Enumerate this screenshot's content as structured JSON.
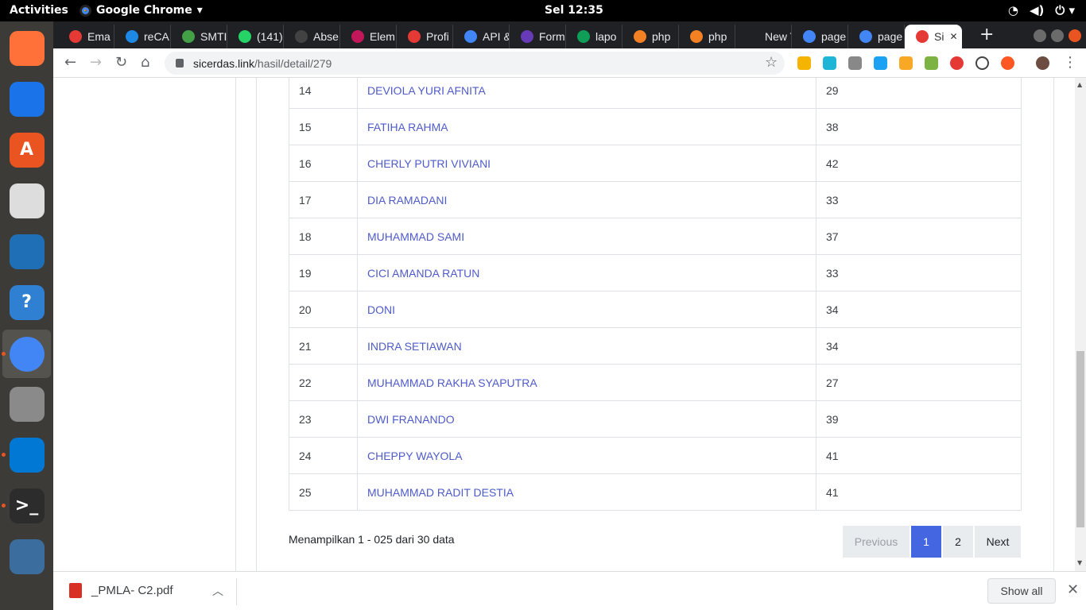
{
  "topbar": {
    "activities": "Activities",
    "app": "Google Chrome",
    "clock": "Sel 12:35"
  },
  "tabs": [
    {
      "label": "Ema",
      "color": "#e53935"
    },
    {
      "label": "reCA",
      "color": "#1e88e5"
    },
    {
      "label": "SMTI",
      "color": "#43a047"
    },
    {
      "label": "(141)",
      "color": "#25d366"
    },
    {
      "label": "Abse",
      "color": "#424242"
    },
    {
      "label": "Elem",
      "color": "#c2185b"
    },
    {
      "label": "Profi",
      "color": "#e53935"
    },
    {
      "label": "API &",
      "color": "#4285f4"
    },
    {
      "label": "Form",
      "color": "#673ab7"
    },
    {
      "label": "lapo",
      "color": "#0f9d58"
    },
    {
      "label": "php",
      "color": "#f48024"
    },
    {
      "label": "php",
      "color": "#f48024"
    },
    {
      "label": "New Tab",
      "color": "#1f2125"
    },
    {
      "label": "page",
      "color": "#4285f4"
    },
    {
      "label": "page",
      "color": "#4285f4"
    },
    {
      "label": "Si",
      "color": "#e53935"
    }
  ],
  "address": {
    "domain": "sicerdas.link",
    "path": "/hasil/detail/279"
  },
  "table": {
    "rows": [
      {
        "no": "14",
        "name": "DEVIOLA YURI AFNITA",
        "score": "29"
      },
      {
        "no": "15",
        "name": "FATIHA RAHMA",
        "score": "38"
      },
      {
        "no": "16",
        "name": "CHERLY PUTRI VIVIANI",
        "score": "42"
      },
      {
        "no": "17",
        "name": "DIA RAMADANI",
        "score": "33"
      },
      {
        "no": "18",
        "name": "MUHAMMAD SAMI",
        "score": "37"
      },
      {
        "no": "19",
        "name": "CICI AMANDA RATUN",
        "score": "33"
      },
      {
        "no": "20",
        "name": "DONI",
        "score": "34"
      },
      {
        "no": "21",
        "name": "INDRA SETIAWAN",
        "score": "34"
      },
      {
        "no": "22",
        "name": "MUHAMMAD RAKHA SYAPUTRA",
        "score": "27"
      },
      {
        "no": "23",
        "name": "DWI FRANANDO",
        "score": "39"
      },
      {
        "no": "24",
        "name": "CHEPPY WAYOLA",
        "score": "41"
      },
      {
        "no": "25",
        "name": "MUHAMMAD RADIT DESTIA",
        "score": "41"
      }
    ]
  },
  "info": "Menampilkan 1 - 025 dari 30 data",
  "pager": {
    "prev": "Previous",
    "p1": "1",
    "p2": "2",
    "next": "Next"
  },
  "downloads": {
    "file": "_PMLA- C2.pdf",
    "show_all": "Show all"
  },
  "dock": [
    {
      "name": "firefox-icon",
      "color": "#ff7139",
      "glyph": ""
    },
    {
      "name": "thunderbird-icon",
      "color": "#1a73e8",
      "glyph": ""
    },
    {
      "name": "software-center-icon",
      "color": "#e95420",
      "glyph": "A"
    },
    {
      "name": "rhythmbox-icon",
      "color": "#ddd",
      "glyph": ""
    },
    {
      "name": "writer-icon",
      "color": "#1e6fb5",
      "glyph": ""
    },
    {
      "name": "help-icon",
      "color": "#2f7fd2",
      "glyph": "?"
    },
    {
      "name": "chrome-icon",
      "color": "#4285f4",
      "glyph": ""
    },
    {
      "name": "files-icon",
      "color": "#8a8a8a",
      "glyph": ""
    },
    {
      "name": "vscode-icon",
      "color": "#0078d4",
      "glyph": ""
    },
    {
      "name": "terminal-icon",
      "color": "#2c2c2c",
      "glyph": ">_"
    },
    {
      "name": "mysql-workbench-icon",
      "color": "#3b6e9e",
      "glyph": ""
    }
  ]
}
